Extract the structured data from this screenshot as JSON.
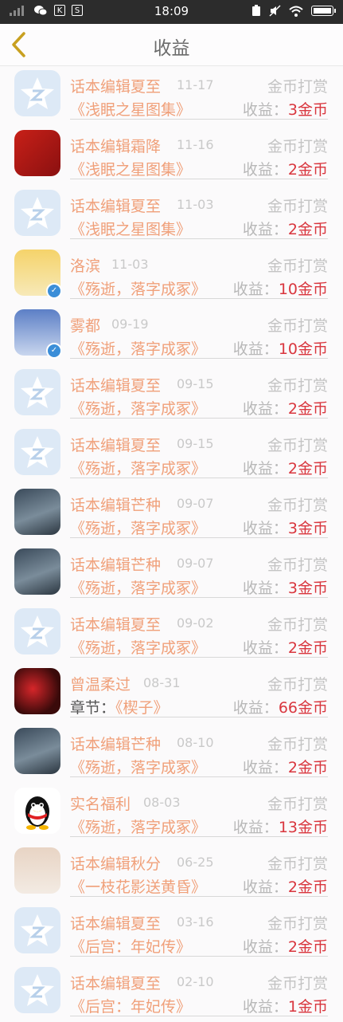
{
  "status_bar": {
    "time": "18:09"
  },
  "header": {
    "title": "收益"
  },
  "labels": {
    "income_prefix": "收益："
  },
  "rows": [
    {
      "avatar": "qzone-star-icon",
      "name": "话本编辑夏至",
      "date": "11-17",
      "type": "金币打赏",
      "prefix": "",
      "book": "《浅眠之星图集》",
      "amount": "3金币"
    },
    {
      "avatar": "book-cover-avatar",
      "name": "话本编辑霜降",
      "date": "11-16",
      "type": "金币打赏",
      "prefix": "",
      "book": "《浅眠之星图集》",
      "amount": "2金币"
    },
    {
      "avatar": "qzone-star-icon",
      "name": "话本编辑夏至",
      "date": "11-03",
      "type": "金币打赏",
      "prefix": "",
      "book": "《浅眠之星图集》",
      "amount": "2金币"
    },
    {
      "avatar": "cat-avatar",
      "name": "洛滨",
      "date": "11-03",
      "type": "金币打赏",
      "prefix": "",
      "book": "《殇逝，落字成冢》",
      "amount": "10金币",
      "verified": true
    },
    {
      "avatar": "girl-avatar",
      "name": "雾都",
      "date": "09-19",
      "type": "金币打赏",
      "prefix": "",
      "book": "《殇逝，落字成冢》",
      "amount": "10金币",
      "verified": true
    },
    {
      "avatar": "qzone-star-icon",
      "name": "话本编辑夏至",
      "date": "09-15",
      "type": "金币打赏",
      "prefix": "",
      "book": "《殇逝，落字成冢》",
      "amount": "2金币"
    },
    {
      "avatar": "qzone-star-icon",
      "name": "话本编辑夏至",
      "date": "09-15",
      "type": "金币打赏",
      "prefix": "",
      "book": "《殇逝，落字成冢》",
      "amount": "2金币"
    },
    {
      "avatar": "car-photo-avatar",
      "name": "话本编辑芒种",
      "date": "09-07",
      "type": "金币打赏",
      "prefix": "",
      "book": "《殇逝，落字成冢》",
      "amount": "3金币"
    },
    {
      "avatar": "car-photo-avatar",
      "name": "话本编辑芒种",
      "date": "09-07",
      "type": "金币打赏",
      "prefix": "",
      "book": "《殇逝，落字成冢》",
      "amount": "3金币"
    },
    {
      "avatar": "qzone-star-icon",
      "name": "话本编辑夏至",
      "date": "09-02",
      "type": "金币打赏",
      "prefix": "",
      "book": "《殇逝，落字成冢》",
      "amount": "2金币"
    },
    {
      "avatar": "dark-red-avatar",
      "name": "曾温柔过",
      "date": "08-31",
      "type": "金币打赏",
      "prefix": "章节：",
      "book": "《楔子》",
      "amount": "66金币"
    },
    {
      "avatar": "car-photo-avatar",
      "name": "话本编辑芒种",
      "date": "08-10",
      "type": "金币打赏",
      "prefix": "",
      "book": "《殇逝，落字成冢》",
      "amount": "2金币"
    },
    {
      "avatar": "qq-penguin-icon",
      "name": "实名福利",
      "date": "08-03",
      "type": "金币打赏",
      "prefix": "",
      "book": "《殇逝，落字成冢》",
      "amount": "13金币"
    },
    {
      "avatar": "bow-girl-avatar",
      "name": "话本编辑秋分",
      "date": "06-25",
      "type": "金币打赏",
      "prefix": "",
      "book": "《一枝花影送黄昏》",
      "amount": "2金币"
    },
    {
      "avatar": "qzone-star-icon",
      "name": "话本编辑夏至",
      "date": "03-16",
      "type": "金币打赏",
      "prefix": "",
      "book": "《后宫：年妃传》",
      "amount": "2金币"
    },
    {
      "avatar": "qzone-star-icon",
      "name": "话本编辑夏至",
      "date": "02-10",
      "type": "金币打赏",
      "prefix": "",
      "book": "《后宫：年妃传》",
      "amount": "1金币"
    }
  ],
  "colors": {
    "name": "#f0a07a",
    "amount": "#d9363e",
    "status_bar": "#2c2c2c",
    "back_arrow": "#c8a020"
  }
}
